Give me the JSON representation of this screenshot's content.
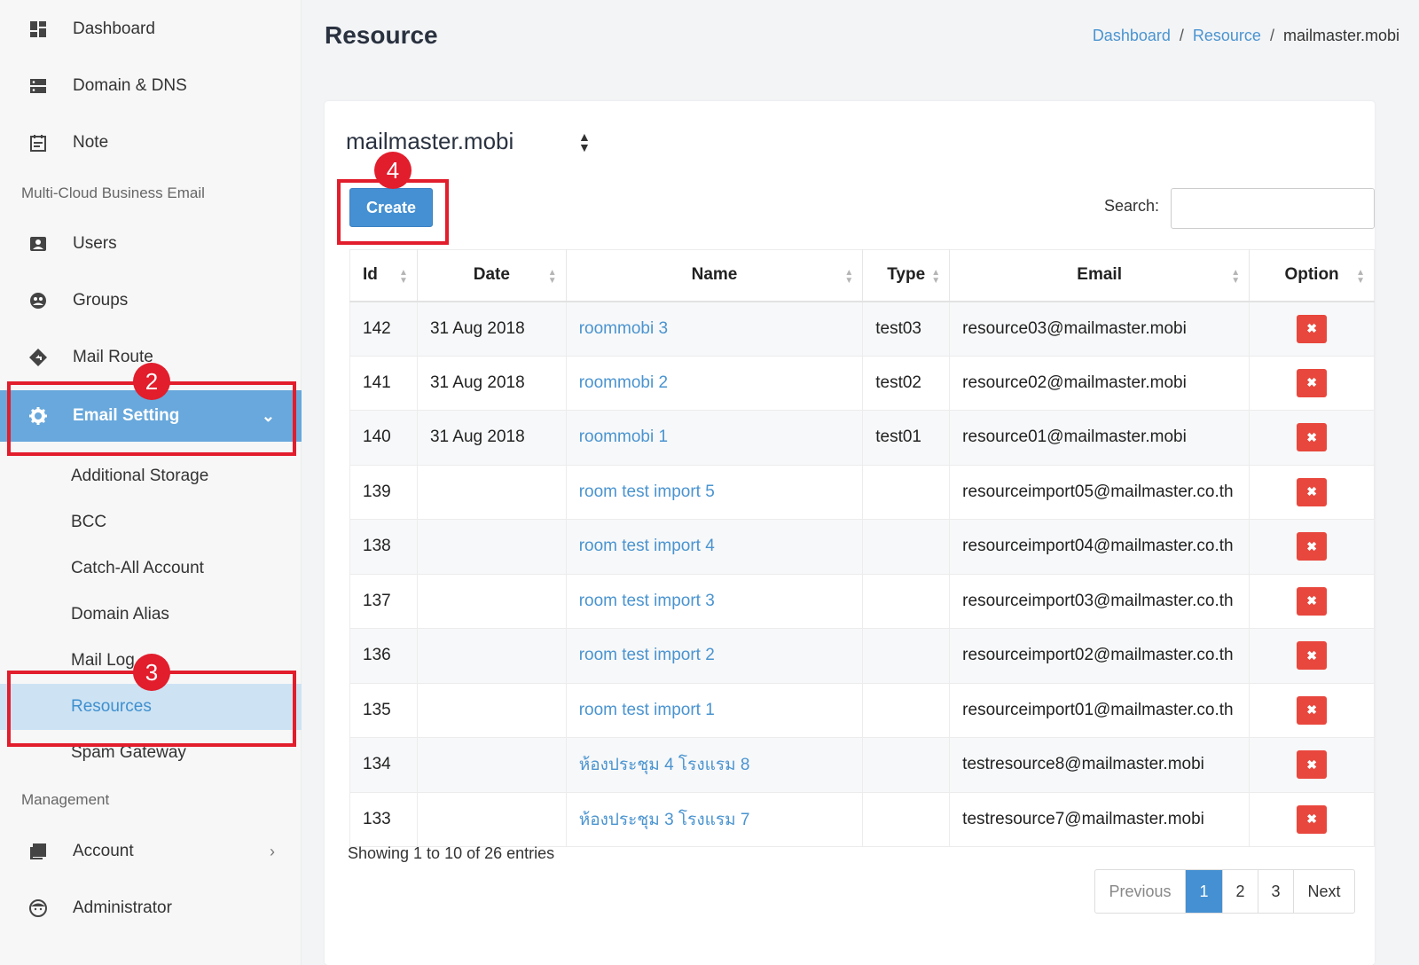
{
  "sidebar": {
    "top_items": [
      {
        "label": "Dashboard",
        "icon": "dashboard-icon"
      },
      {
        "label": "Domain & DNS",
        "icon": "server-icon"
      },
      {
        "label": "Note",
        "icon": "note-icon"
      }
    ],
    "section_business": "Multi-Cloud Business Email",
    "business_items": [
      {
        "label": "Users",
        "icon": "user-card-icon"
      },
      {
        "label": "Groups",
        "icon": "groups-icon"
      },
      {
        "label": "Mail Route",
        "icon": "route-icon"
      },
      {
        "label": "Email Setting",
        "icon": "gear-icon"
      }
    ],
    "email_setting_children": [
      "Additional Storage",
      "BCC",
      "Catch-All Account",
      "Domain Alias",
      "Mail Log",
      "Resources",
      "Spam Gateway"
    ],
    "section_management": "Management",
    "management_items": [
      {
        "label": "Account",
        "icon": "account-icon"
      },
      {
        "label": "Administrator",
        "icon": "admin-face-icon"
      }
    ],
    "active_item": "Email Setting",
    "active_child": "Resources",
    "accent_color": "#68a8dc"
  },
  "header": {
    "title": "Resource",
    "breadcrumb": [
      "Dashboard",
      "Resource",
      "mailmaster.mobi"
    ]
  },
  "main": {
    "domain": "mailmaster.mobi",
    "create_label": "Create",
    "search_label": "Search:",
    "search_value": "",
    "columns": [
      "Id",
      "Date",
      "Name",
      "Type",
      "Email",
      "Option"
    ],
    "rows": [
      {
        "id": "142",
        "date": "31 Aug 2018",
        "name": "roommobi 3",
        "type": "test03",
        "email": "resource03@mailmaster.mobi"
      },
      {
        "id": "141",
        "date": "31 Aug 2018",
        "name": "roommobi 2",
        "type": "test02",
        "email": "resource02@mailmaster.mobi"
      },
      {
        "id": "140",
        "date": "31 Aug 2018",
        "name": "roommobi 1",
        "type": "test01",
        "email": "resource01@mailmaster.mobi"
      },
      {
        "id": "139",
        "date": "",
        "name": "room test import 5",
        "type": "",
        "email": "resourceimport05@mailmaster.co.th"
      },
      {
        "id": "138",
        "date": "",
        "name": "room test import 4",
        "type": "",
        "email": "resourceimport04@mailmaster.co.th"
      },
      {
        "id": "137",
        "date": "",
        "name": "room test import 3",
        "type": "",
        "email": "resourceimport03@mailmaster.co.th"
      },
      {
        "id": "136",
        "date": "",
        "name": "room test import 2",
        "type": "",
        "email": "resourceimport02@mailmaster.co.th"
      },
      {
        "id": "135",
        "date": "",
        "name": "room test import 1",
        "type": "",
        "email": "resourceimport01@mailmaster.co.th"
      },
      {
        "id": "134",
        "date": "",
        "name": "ห้องประชุม 4 โรงแรม 8",
        "type": "",
        "email": "testresource8@mailmaster.mobi"
      },
      {
        "id": "133",
        "date": "",
        "name": "ห้องประชุม 3 โรงแรม 7",
        "type": "",
        "email": "testresource7@mailmaster.mobi"
      }
    ],
    "delete_icon": "close-icon",
    "delete_color": "#e8473d",
    "info": "Showing 1 to 10 of 26 entries",
    "pagination": {
      "previous": "Previous",
      "pages": [
        "1",
        "2",
        "3"
      ],
      "current": "1",
      "next": "Next"
    }
  },
  "callouts": {
    "two": "2",
    "three": "3",
    "four": "4",
    "color": "#e21d2c"
  }
}
